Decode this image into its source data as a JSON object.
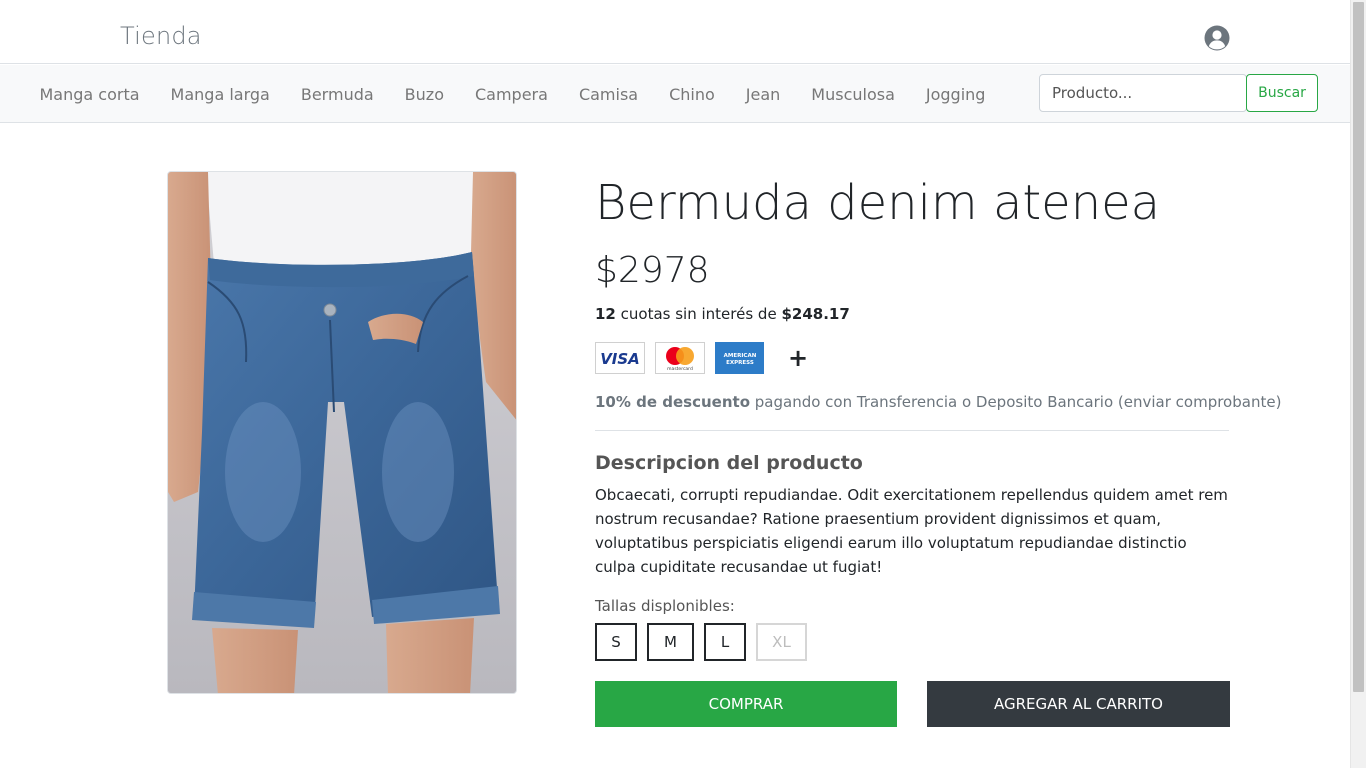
{
  "header": {
    "brand": "Tienda",
    "user_icon": "user-circle-icon"
  },
  "nav": {
    "items": [
      {
        "label": "Manga corta"
      },
      {
        "label": "Manga larga"
      },
      {
        "label": "Bermuda"
      },
      {
        "label": "Buzo"
      },
      {
        "label": "Campera"
      },
      {
        "label": "Camisa"
      },
      {
        "label": "Chino"
      },
      {
        "label": "Jean"
      },
      {
        "label": "Musculosa"
      },
      {
        "label": "Jogging"
      }
    ],
    "search": {
      "placeholder": "Producto...",
      "value": "",
      "button_label": "Buscar"
    }
  },
  "product": {
    "title": "Bermuda denim atenea",
    "price": "$2978",
    "installments": {
      "count": "12",
      "text": " cuotas sin interés de ",
      "amount": "$248.17"
    },
    "payment_methods": [
      {
        "name": "VISA",
        "icon": "visa-card-icon"
      },
      {
        "name": "mastercard",
        "icon": "mastercard-icon"
      },
      {
        "name": "AMERICAN EXPRESS",
        "icon": "amex-card-icon"
      }
    ],
    "more_icon": "plus-icon",
    "discount": {
      "bold": "10% de descuento",
      "text": " pagando con Transferencia o Deposito Bancario (enviar comprobante)"
    },
    "description_heading": "Descripcion del producto",
    "description": "Obcaecati, corrupti repudiandae. Odit exercitationem repellendus quidem amet rem nostrum recusandae? Ratione praesentium provident dignissimos et quam, voluptatibus perspiciatis eligendi earum illo voluptatum repudiandae distinctio culpa cupiditate recusandae ut fugiat!",
    "sizes_label": "Tallas displonibles:",
    "sizes": [
      {
        "label": "S",
        "available": true
      },
      {
        "label": "M",
        "available": true
      },
      {
        "label": "L",
        "available": true
      },
      {
        "label": "XL",
        "available": false
      }
    ],
    "buy_label": "COMPRAR",
    "cart_label": "AGREGAR AL CARRITO"
  },
  "colors": {
    "accent_green": "#28a745",
    "dark": "#343a40",
    "denim": "#3d6a9e"
  }
}
